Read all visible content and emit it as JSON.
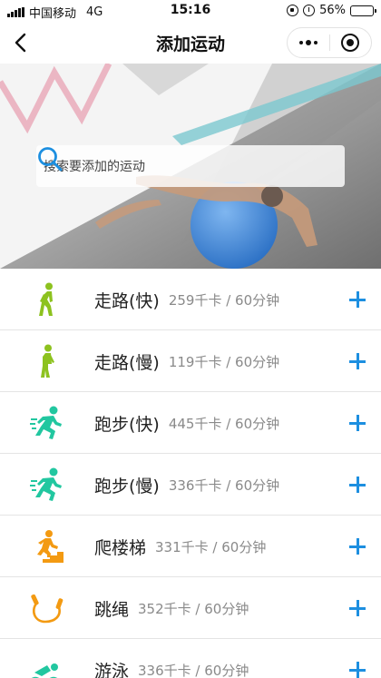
{
  "status_bar": {
    "carrier": "中国移动",
    "network": "4G",
    "time": "15:16",
    "battery_percent": "56%",
    "battery_level": 0.56
  },
  "nav": {
    "title": "添加运动"
  },
  "search": {
    "placeholder": "搜索要添加的运动"
  },
  "colors": {
    "accent": "#1d8fe0",
    "walk_icon": "#8dc21f",
    "run_icon": "#22c7a0",
    "climb_icon": "#f39a12",
    "rope_icon": "#f39a12",
    "swim_icon": "#22c7a0"
  },
  "activities": [
    {
      "name": "走路(快)",
      "stats": "259千卡 / 60分钟",
      "icon": "walking-icon"
    },
    {
      "name": "走路(慢)",
      "stats": "119千卡 / 60分钟",
      "icon": "walking-icon"
    },
    {
      "name": "跑步(快)",
      "stats": "445千卡 / 60分钟",
      "icon": "running-icon"
    },
    {
      "name": "跑步(慢)",
      "stats": "336千卡 / 60分钟",
      "icon": "running-icon"
    },
    {
      "name": "爬楼梯",
      "stats": "331千卡 / 60分钟",
      "icon": "stair-climbing-icon"
    },
    {
      "name": "跳绳",
      "stats": "352千卡 / 60分钟",
      "icon": "jump-rope-icon"
    },
    {
      "name": "游泳",
      "stats": "336千卡 / 60分钟",
      "icon": "swimming-icon"
    }
  ]
}
